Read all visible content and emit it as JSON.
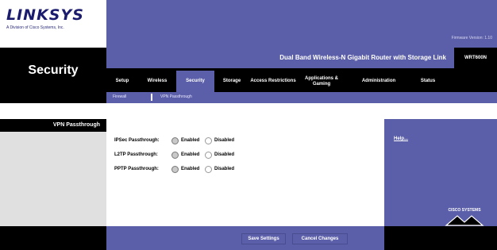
{
  "header": {
    "logo_text": "LINKSYS",
    "logo_sub": "A Division of Cisco Systems, Inc.",
    "firmware": "Firmware Version: 1.10",
    "product_name": "Dual Band Wireless-N Gigabit Router with Storage Link",
    "model": "WRT600N"
  },
  "section": {
    "title": "Security"
  },
  "tabs": [
    {
      "label": "Setup"
    },
    {
      "label": "Wireless"
    },
    {
      "label": "Security"
    },
    {
      "label": "Storage"
    },
    {
      "label": "Access Restrictions"
    },
    {
      "label": "Applications & Gaming"
    },
    {
      "label": "Administration"
    },
    {
      "label": "Status"
    }
  ],
  "subtabs": [
    {
      "label": "Firewall"
    },
    {
      "label": "VPN Passthrough"
    }
  ],
  "left_label": "VPN Passthrough",
  "form": {
    "rows": [
      {
        "label": "IPSec Passthrough:",
        "enabled": "Enabled",
        "disabled": "Disabled",
        "value": "Enabled"
      },
      {
        "label": "L2TP Passthrough:",
        "enabled": "Enabled",
        "disabled": "Disabled",
        "value": "Enabled"
      },
      {
        "label": "PPTP Passthrough:",
        "enabled": "Enabled",
        "disabled": "Disabled",
        "value": "Enabled"
      }
    ]
  },
  "help": {
    "label": "Help..."
  },
  "buttons": {
    "save": "Save Settings",
    "cancel": "Cancel Changes"
  },
  "cisco": {
    "label": "CISCO SYSTEMS"
  },
  "colors": {
    "brand_purple": "#5b5ea8",
    "black": "#000000"
  }
}
